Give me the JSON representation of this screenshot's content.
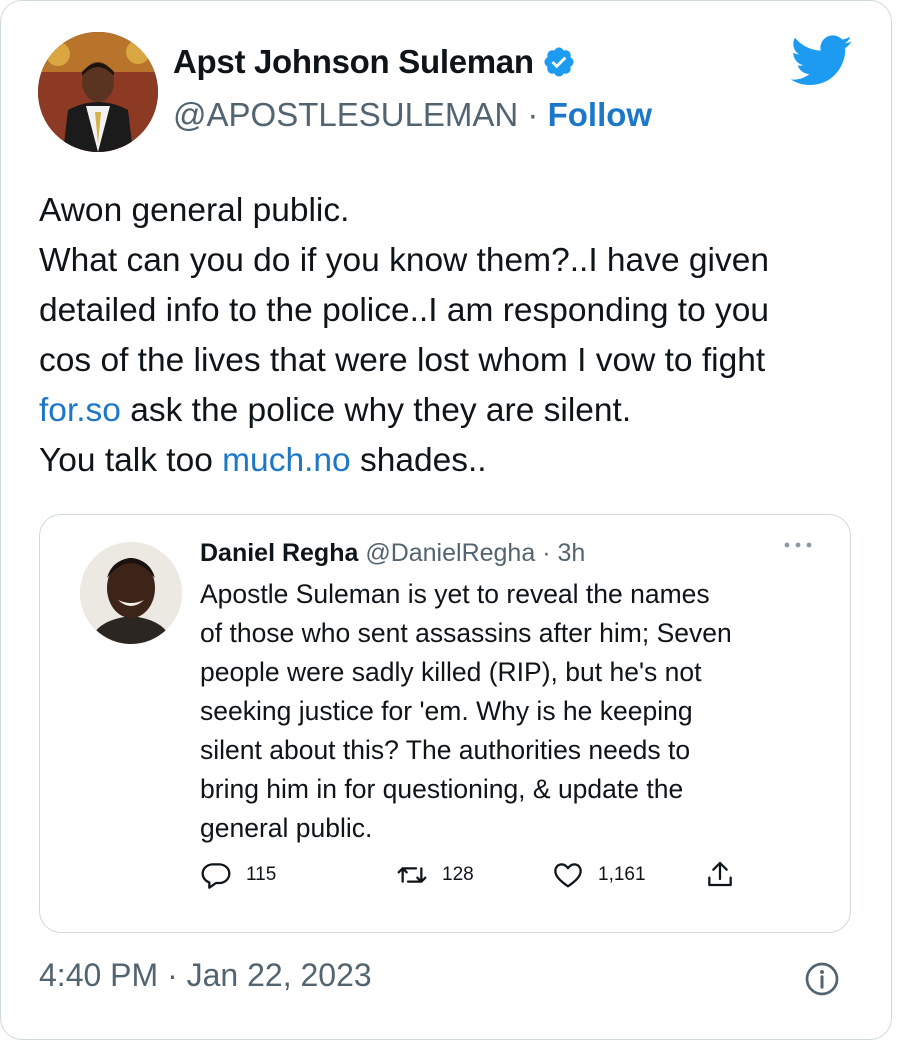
{
  "author": {
    "name": "Apst Johnson Suleman",
    "handle": "@APOSTLESULEMAN",
    "separator": " · ",
    "follow_label": "Follow",
    "verified_icon": "verified-badge-icon"
  },
  "tweet": {
    "lines": [
      [
        {
          "t": "Awon general public."
        }
      ],
      [
        {
          "t": "What can you do if you know them?..I have given"
        }
      ],
      [
        {
          "t": "detailed info to the police..I am responding to you"
        }
      ],
      [
        {
          "t": "cos of the lives that were lost whom I vow to fight"
        }
      ],
      [
        {
          "t": "for.so",
          "link": true
        },
        {
          "t": " ask the police why they are silent."
        }
      ],
      [
        {
          "t": "You talk too "
        },
        {
          "t": "much.no",
          "link": true
        },
        {
          "t": " shades.."
        }
      ]
    ]
  },
  "quote": {
    "name": "Daniel Regha",
    "handle": " @DanielRegha",
    "time": " · 3h",
    "lines": [
      "Apostle Suleman is yet to reveal the names",
      "of those who sent assassins after him; Seven",
      "people were sadly killed (RIP), but he's not",
      "seeking justice for 'em. Why is he keeping",
      "silent about this? The authorities needs to",
      "bring him in for questioning, & update the",
      "general public."
    ],
    "replies": "115",
    "retweets": "128",
    "likes": "1,161"
  },
  "timestamp": "4:40 PM · Jan 22, 2023",
  "colors": {
    "link": "#1d77c8",
    "twitter_blue": "#1d9bf0",
    "secondary_text": "#536471",
    "border": "#cfd9de"
  }
}
